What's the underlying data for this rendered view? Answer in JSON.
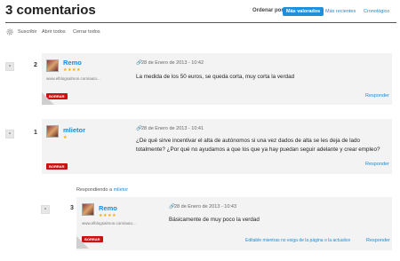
{
  "header": {
    "title": "3 comentarios",
    "order_label": "Ordenar por:",
    "order_options": [
      "Más valorados",
      "Más recientes",
      "Cronológico"
    ]
  },
  "toolbar": {
    "items": [
      "Suscribir",
      "Abrir todos",
      "Cerrar todos"
    ]
  },
  "comments": [
    {
      "collapse": "-",
      "number": "2",
      "author": "Remo",
      "stars": "★★★★",
      "url": "www.elblogsalmon.com/auto...",
      "delete": "BORRAR",
      "date": "28 de Enero de 2013 - 10:42",
      "text": "La medida de los 50 euros, se queda corta, muy corta la verdad",
      "reply": "Responder"
    },
    {
      "collapse": "-",
      "number": "1",
      "author": "mlietor",
      "stars": "★",
      "delete": "BORRAR",
      "date": "28 de Enero de 2013 - 10:41",
      "text": "¿De qué sirve incentivar el alta de autónomos si una vez dados de alta se les deja de lado totalmente? ¿Por qué no ayudamos a que los que ya hay puedan seguir adelante y crear empleo?",
      "reply": "Responder"
    },
    {
      "responding_prefix": "Respondiendo a",
      "responding_to": "mlietor",
      "collapse": "-",
      "number": "3",
      "author": "Remo",
      "stars": "★★★★",
      "url": "www.elblogsalmon.com/auto...",
      "delete": "BORRAR",
      "date": "28 de Enero de 2013 - 10:43",
      "text": "Básicamente de muy poco la verdad",
      "editable_note": "Editable mientras no exiga de la página o la actualice",
      "reply": "Responder"
    }
  ],
  "colors": {
    "accent": "#1f8fdc",
    "delete": "#cc1111",
    "star": "#f0a800"
  }
}
